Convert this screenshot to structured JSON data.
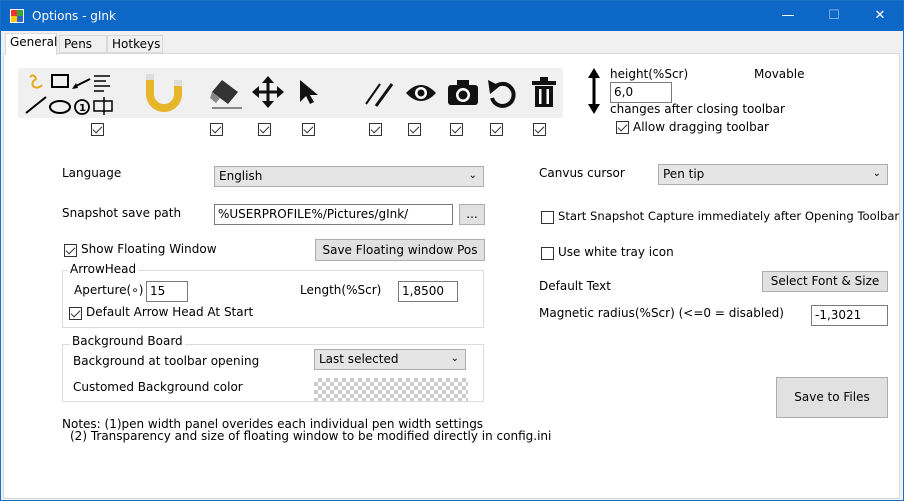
{
  "window": {
    "title": "Options - gInk",
    "minimize": "—",
    "maximize": "☐",
    "close": "✕"
  },
  "tabs": [
    {
      "label": "General"
    },
    {
      "label": "Pens"
    },
    {
      "label": "Hotkeys"
    }
  ],
  "toolbar": {
    "height_label": "height(%Scr)",
    "height_value": "6,0",
    "movable_label": "Movable",
    "changes_note": "changes after closing toolbar",
    "allow_drag_label": "Allow dragging toolbar",
    "tools": [
      {
        "icon": "shapes-icon",
        "checked": true
      },
      {
        "icon": "magnet-icon",
        "checked": true
      },
      {
        "icon": "eraser-icon",
        "checked": true
      },
      {
        "icon": "move-icon",
        "checked": true
      },
      {
        "icon": "pointer-icon",
        "checked": true
      },
      {
        "icon": "pen-width-icon",
        "checked": true
      },
      {
        "icon": "eye-icon",
        "checked": true
      },
      {
        "icon": "camera-icon",
        "checked": true
      },
      {
        "icon": "undo-icon",
        "checked": true
      },
      {
        "icon": "trash-icon",
        "checked": true
      }
    ]
  },
  "left": {
    "language_label": "Language",
    "language_value": "English",
    "snapshot_label": "Snapshot save path",
    "snapshot_value": "%USERPROFILE%/Pictures/gInk/",
    "browse_label": "...",
    "show_floating_label": "Show Floating Window",
    "save_floating_label": "Save Floating window Pos",
    "arrowhead": {
      "title": "ArrowHead",
      "aperture_label": "Aperture(∘)",
      "aperture_value": "15",
      "length_label": "Length(%Scr)",
      "length_value": "1,8500",
      "default_label": "Default Arrow Head At Start"
    },
    "background": {
      "title": "Background Board",
      "opening_label": "Background at toolbar opening",
      "opening_value": "Last selected",
      "custom_label": "Customed Background color"
    },
    "notes_line1": "Notes: (1)pen width panel overides each individual pen width settings",
    "notes_line2": "(2) Transparency and size of floating window to be modified directly in config.ini"
  },
  "right": {
    "cursor_label": "Canvus cursor",
    "cursor_value": "Pen tip",
    "snapshot_capture_label": "Start Snapshot Capture immediately after Opening Toolbar",
    "white_tray_label": "Use white tray icon",
    "default_text_label": "Default Text",
    "select_font_label": "Select Font & Size",
    "magnetic_label": "Magnetic radius(%Scr) (<=0 = disabled)",
    "magnetic_value": "-1,3021",
    "save_files_label": "Save to Files"
  }
}
